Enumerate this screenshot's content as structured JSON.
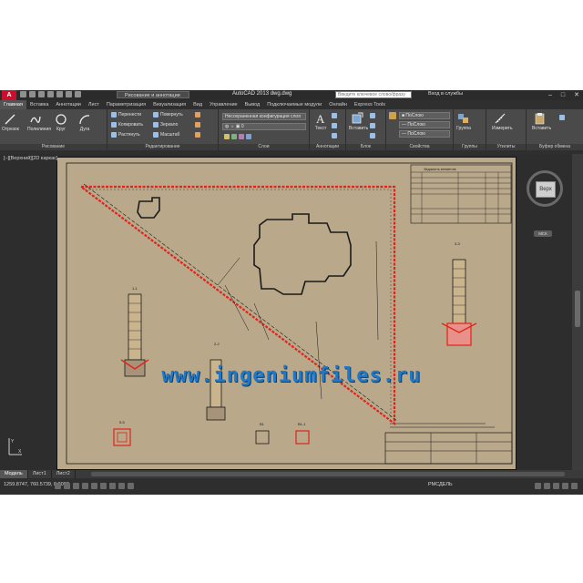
{
  "app": {
    "title": "AutoCAD 2013   dwg.dwg",
    "logo_letter": "A",
    "workspace": "Рисование и аннотации",
    "search_placeholder": "Введите ключевое слово/фразу",
    "sign_in": "Вход в службы",
    "window_controls": [
      "–",
      "□",
      "✕"
    ]
  },
  "ribbon_tabs": [
    "Главная",
    "Вставка",
    "Аннотации",
    "Лист",
    "Параметризация",
    "Визуализация",
    "Вид",
    "Управление",
    "Вывод",
    "Подключаемые модули",
    "Онлайн",
    "Express Tools"
  ],
  "ribbon": {
    "draw": {
      "title": "Рисование",
      "tools": [
        "Отрезок",
        "Полилиния",
        "Круг",
        "Дуга"
      ]
    },
    "modify": {
      "title": "Редактирование",
      "rows": [
        [
          "Перенести",
          "Повернуть"
        ],
        [
          "Копировать",
          "Зеркало"
        ],
        [
          "Растянуть",
          "Масштаб"
        ]
      ]
    },
    "layers": {
      "title": "Слои",
      "dropdown1": "Несохраненная конфигурация слоя",
      "dropdown2": "0"
    },
    "annotation": {
      "title": "Аннотации",
      "text_label": "Текст"
    },
    "block": {
      "title": "Блок",
      "insert_label": "Вставить"
    },
    "properties": {
      "title": "Свойства",
      "color": "ПоСлою",
      "linetype": "ПоСлою",
      "lineweight": "ПоСлою"
    },
    "groups": {
      "title": "Группы",
      "label": "Группа"
    },
    "utilities": {
      "title": "Утилиты",
      "label": "Измерить"
    },
    "clipboard": {
      "title": "Буфер обмена",
      "label": "Вставить"
    }
  },
  "viewport": {
    "label": "[–][Верхний][2D каркас]",
    "viewcube_face": "Верх",
    "wcs": "МСК"
  },
  "layout_tabs": [
    "Модель",
    "Лист1",
    "Лист2"
  ],
  "status": {
    "coords": "1259.8747, 760.5739, 0.0000",
    "model": "РМСДЕЛЬ"
  },
  "watermark": "www.ingeniumfiles.ru",
  "drawing": {
    "labels": [
      "1-1",
      "2-2",
      "3-3",
      "5-5",
      "В1",
      "В1-1"
    ],
    "table_title": "Ведомость элементов"
  },
  "colors": {
    "paper": "#b9a88a",
    "fence": "#e0241b",
    "line": "#1a1a1a",
    "watermark": "#1f78c8"
  }
}
